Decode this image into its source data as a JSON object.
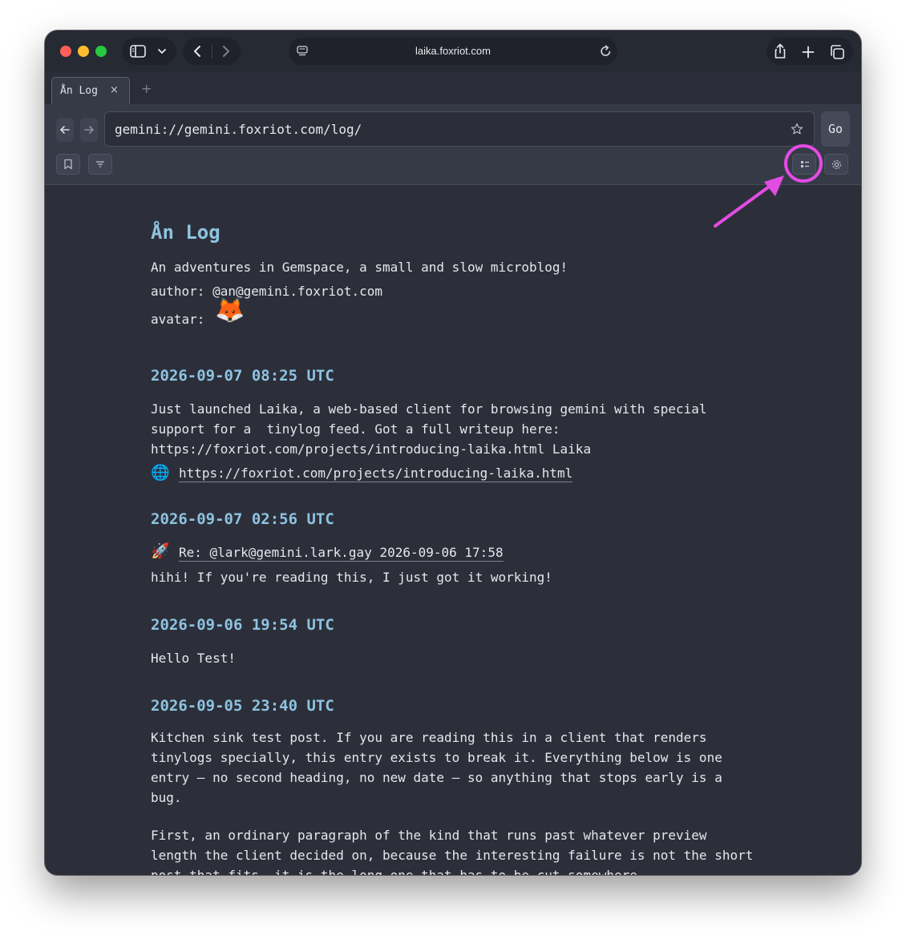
{
  "browser": {
    "url": "laika.foxriot.com",
    "icons": [
      "sidebar-icon",
      "chevron-down-icon",
      "back-icon",
      "forward-icon",
      "site-settings-icon",
      "reload-icon",
      "share-icon",
      "new-tab-icon",
      "tabs-overview-icon"
    ]
  },
  "app": {
    "tab": {
      "label": "Ån Log",
      "close": "×"
    },
    "new_tab": "+",
    "address": "gemini://gemini.foxriot.com/log/",
    "go_label": "Go",
    "toolbar_icons": [
      "bookmark-icon",
      "filter-icon",
      "tinylog-view-icon",
      "settings-icon"
    ]
  },
  "annotation": {
    "color": "#e34ce3"
  },
  "page": {
    "title": "Ån Log",
    "description": "An adventures in Gemspace, a small and slow microblog!",
    "author": "author: @an@gemini.foxriot.com",
    "avatar_label": "avatar:",
    "avatar": "🦊",
    "entries": [
      {
        "date": "2026-09-07 08:25 UTC",
        "lines": [
          "Just launched Laika, a web-based client for browsing gemini with special",
          "support for a  tinylog feed. Got a full writeup here:",
          "https://foxriot.com/projects/introducing-laika.html Laika"
        ],
        "link_icon": "🌐",
        "link": "https://foxriot.com/projects/introducing-laika.html"
      },
      {
        "date": "2026-09-07 02:56 UTC",
        "reply_icon": "🚀",
        "reply": "Re: @lark@gemini.lark.gay 2026-09-06 17:58",
        "text": "hihi! If you're reading this, I just got it working!"
      },
      {
        "date": "2026-09-06 19:54 UTC",
        "text": "Hello Test!"
      },
      {
        "date": "2026-09-05 23:40 UTC",
        "para1": "Kitchen sink test post. If you are reading this in a client that renders tinylogs specially, this entry exists to break it. Everything below is one entry — no second heading, no new date — so anything that stops early is a bug.",
        "para2": "First, an ordinary paragraph of the kind that runs past whatever preview length the client decided on, because the interesting failure is not the short post that fits, it is the long one that has to be cut somewhere."
      }
    ]
  }
}
